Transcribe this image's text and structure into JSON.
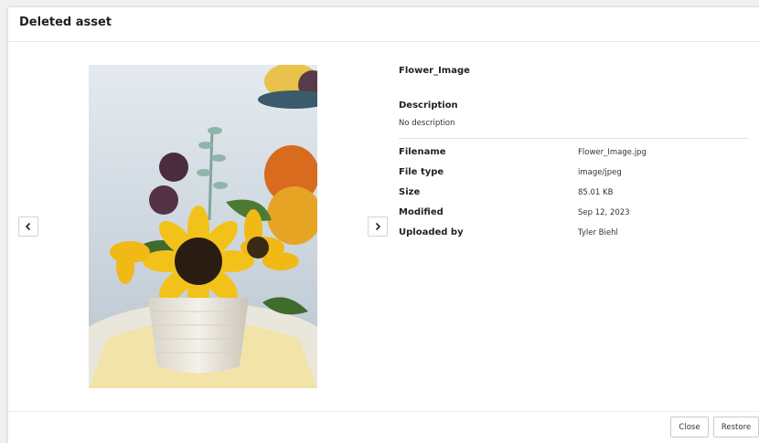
{
  "dialog": {
    "title": "Deleted asset"
  },
  "asset": {
    "name": "Flower_Image",
    "description_label": "Description",
    "description_value": "No description",
    "details": [
      {
        "label": "Filename",
        "value": "Flower_Image.jpg"
      },
      {
        "label": "File type",
        "value": "image/jpeg"
      },
      {
        "label": "Size",
        "value": "85.01 KB"
      },
      {
        "label": "Modified",
        "value": "Sep 12, 2023"
      },
      {
        "label": "Uploaded by",
        "value": "Tyler Biehl"
      }
    ]
  },
  "navigation": {
    "prev_icon": "chevron-left-icon",
    "next_icon": "chevron-right-icon"
  },
  "footer": {
    "close_label": "Close",
    "restore_label": "Restore"
  },
  "colors": {
    "sunflower": "#f2c21b",
    "pumpkin": "#e0781f",
    "background": "#eef0f2"
  }
}
